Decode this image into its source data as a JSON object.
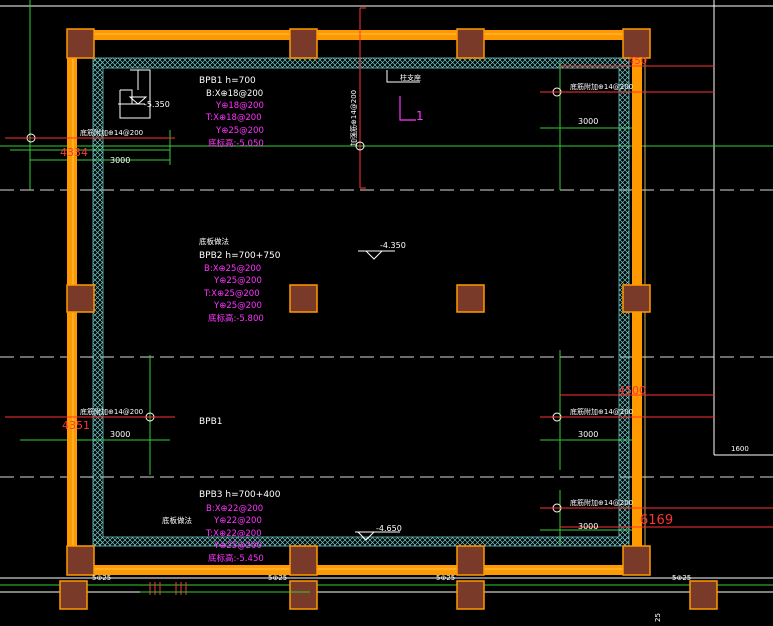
{
  "colors": {
    "background": "#000000",
    "wall": "#ff9900",
    "column": "#7a3a2a",
    "hatch": "#6fc8c8",
    "green": "#33cc33",
    "white": "#ffffff",
    "magenta": "#ff33ff",
    "red": "#ff3333"
  },
  "labels": {
    "bpb1_title": "BPB1 h=700",
    "bpb1_bx": "B:X⊕18@200",
    "bpb1_y": "Y⊕18@200",
    "bpb1_tx": "T:X⊕18@200",
    "bpb1_y2": "Y⊕25@200",
    "bpb1_elev": "底标高:-5.050",
    "level_sym": "-5.350",
    "center_label": "加强筋⊕14@200",
    "legend_box": "柱支座",
    "l1_mark": "L1",
    "bpb2_caption": "底板做法",
    "bpb2_title": "BPB2 h=700+750",
    "bpb2_bx": "B:X⊕25@200",
    "bpb2_y": "Y⊕25@200",
    "bpb2_tx": "T:X⊕25@200",
    "bpb2_y2": "Y⊕25@200",
    "bpb2_elev": "底标高:-5.800",
    "level_center": "-4.350",
    "bpb1_mid": "BPB1",
    "bpb3_title": "BPB3 h=700+400",
    "bpb3_bx": "B:X⊕22@200",
    "bpb3_y": "Y⊕22@200",
    "bpb3_tx": "T:X⊕22@200",
    "bpb3_y2": "Y⊕25@200",
    "bpb3_elev": "底标高:-5.450",
    "bpb3_caption": "底板做法",
    "level_bottom": "-4.650",
    "add_bar_left_top": "底筋附加⊕14@200",
    "dim_left_top": "4334",
    "dim_3000_lt": "3000",
    "add_bar_left_mid": "底筋附加⊕14@200",
    "dim_left_mid": "4351",
    "dim_3000_lm": "3000",
    "add_bar_right_top": "底筋附加⊕14@200",
    "dim_3000_rt": "3000",
    "dim_right_top_red": "450",
    "add_bar_right_mid": "底筋附加⊕14@200",
    "dim_3000_rm": "3000",
    "dim_right_mid_red": "4500",
    "add_bar_right_bot": "底筋附加⊕14@200",
    "dim_3000_rb": "3000",
    "dim_right_bot_red": "6169",
    "dim_1600": "1600",
    "bottom_1": "5⊕25",
    "bottom_2": "5⊕25",
    "bottom_3": "5⊕25",
    "bottom_4": "5⊕25",
    "bottom_edge": "25"
  }
}
